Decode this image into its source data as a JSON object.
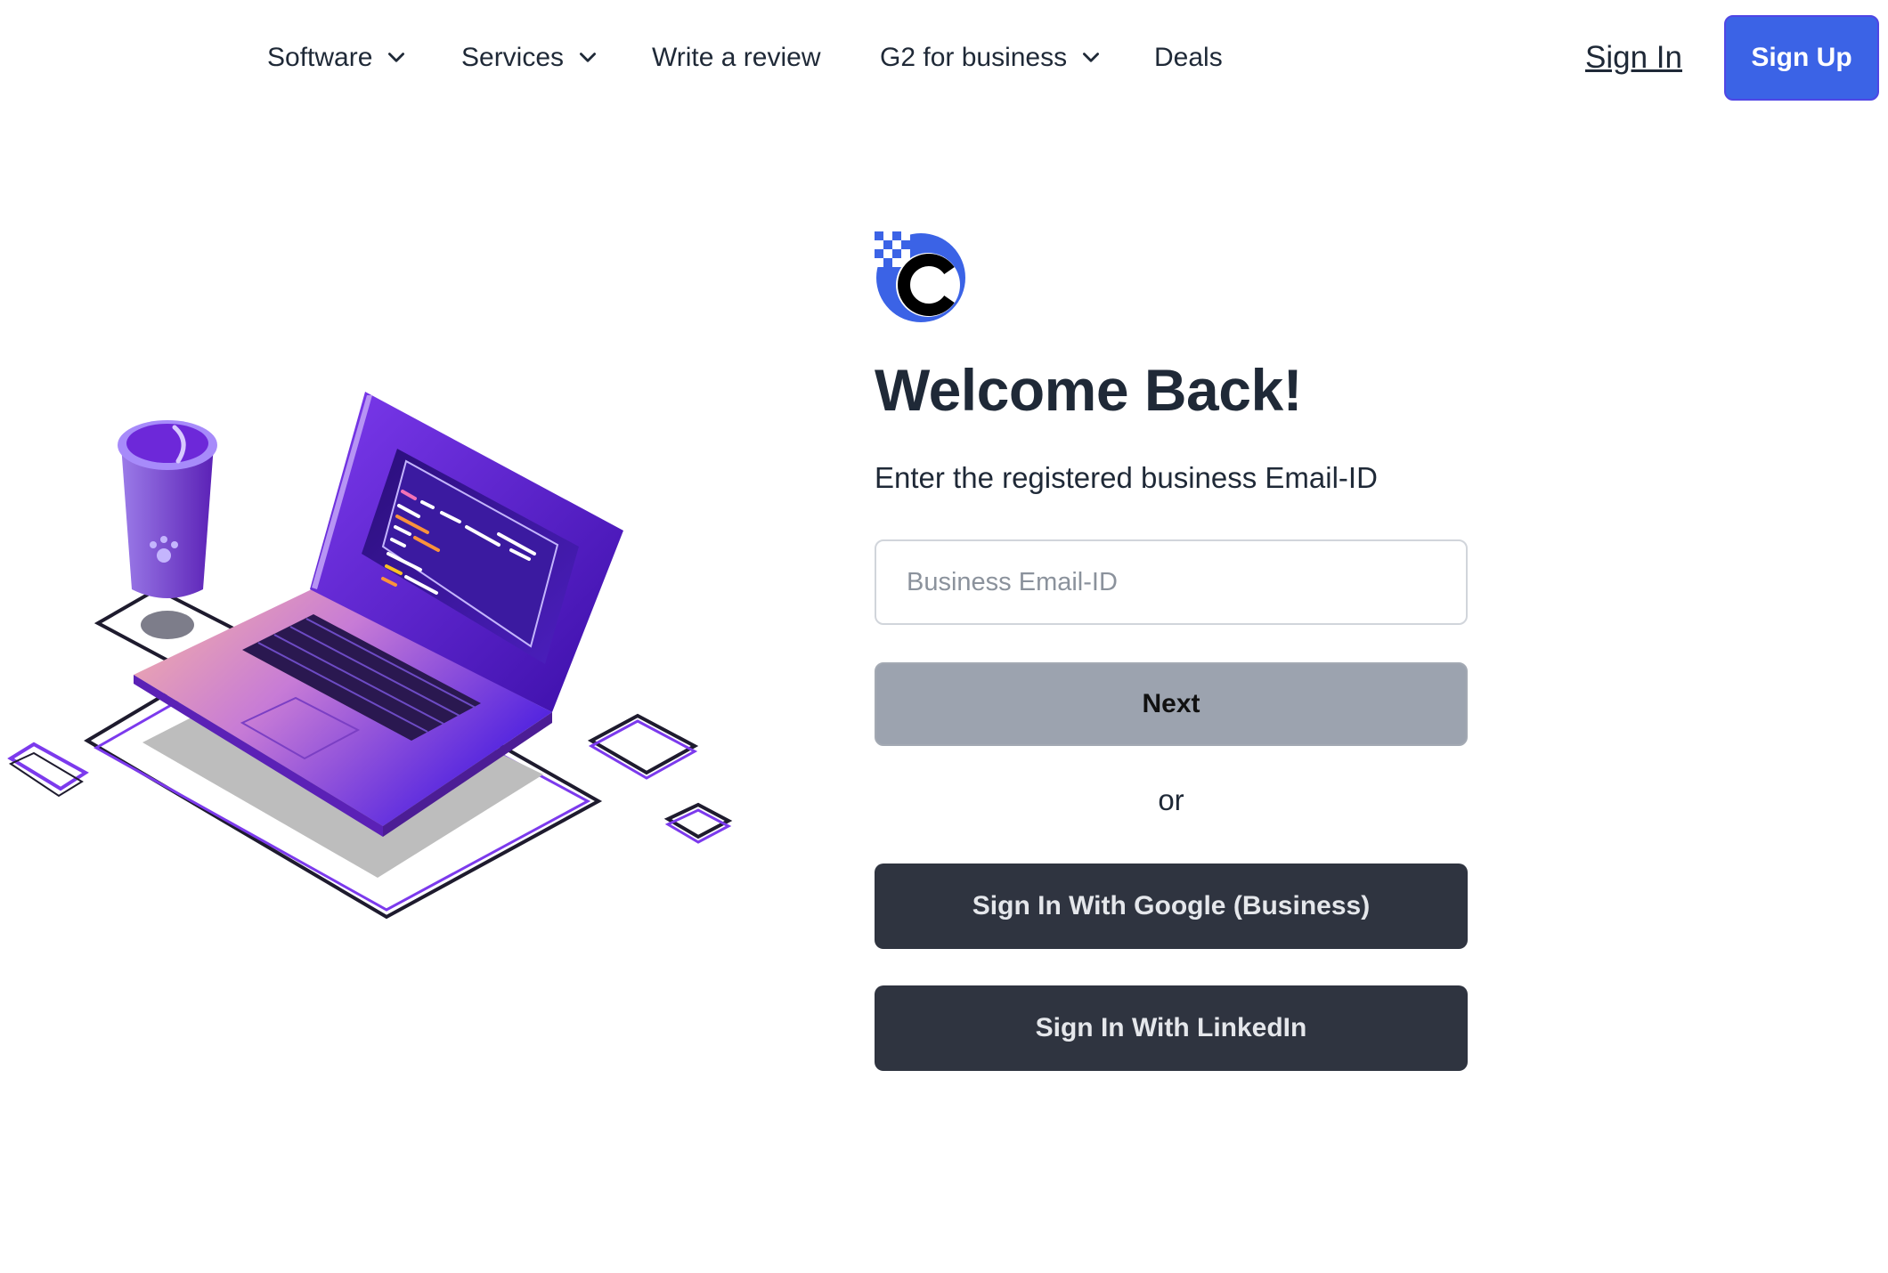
{
  "nav": {
    "items": [
      {
        "label": "Software",
        "has_dropdown": true
      },
      {
        "label": "Services",
        "has_dropdown": true
      },
      {
        "label": "Write a review",
        "has_dropdown": false
      },
      {
        "label": "G2 for business",
        "has_dropdown": true
      },
      {
        "label": "Deals",
        "has_dropdown": false
      }
    ],
    "sign_in": "Sign In",
    "sign_up": "Sign Up"
  },
  "login": {
    "title": "Welcome Back!",
    "subtitle": "Enter the registered business Email-ID",
    "email_placeholder": "Business Email-ID",
    "email_value": "",
    "next_label": "Next",
    "or_text": "or",
    "google_label": "Sign In With Google (Business)",
    "linkedin_label": "Sign In With LinkedIn"
  },
  "colors": {
    "primary": "#3b63e6",
    "dark_button": "#2f3440",
    "disabled_button": "#9ca3af",
    "illustration_purple": "#6d28d9"
  },
  "icons": {
    "dropdown": "chevron-down-icon",
    "logo": "brand-logo",
    "illustration": "laptop-illustration"
  }
}
